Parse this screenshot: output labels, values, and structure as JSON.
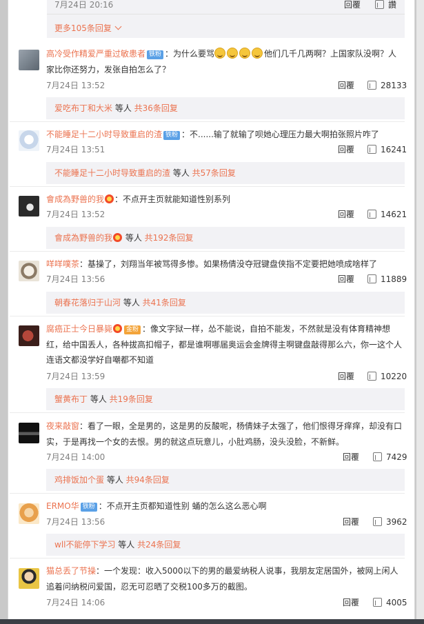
{
  "top": {
    "date": "7月24日 20:16",
    "reply": "回覆",
    "like": "讚",
    "more": "更多105条回复"
  },
  "reply_label": "回覆",
  "comments": [
    {
      "user": "高冷受作精爱严重过敏患者",
      "badge": "铁粉",
      "text_a": "：为什么要骂",
      "text_b": "他们几千几两啊？上国家队没啊？人家比你还努力，发张自拍怎么了？",
      "time": "7月24日 13:52",
      "likes": "28133",
      "r_user": "爱吃布丁和大米",
      "r_mid": " 等人 ",
      "r_count": "共36条回复"
    },
    {
      "user": "不能睡足十二小时导致重启的渣",
      "badge": "铁粉",
      "text": "：不......输了就输了呗她心理压力最大啊拍张照片咋了",
      "time": "7月24日 13:51",
      "likes": "16241",
      "r_user": "不能睡足十二小时导致重启的渣",
      "r_mid": " 等人 ",
      "r_count": "共57条回复"
    },
    {
      "user": "會成為野兽的我",
      "text": "：不点开主页就能知道性别系列",
      "time": "7月24日 13:52",
      "likes": "14621",
      "r_user": "會成為野兽的我",
      "r_mid": " 等人 ",
      "r_count": "共192条回复"
    },
    {
      "user": "咩咩噗茶",
      "text": "：基操了，刘翔当年被骂得多惨。如果杨倩没夺冠键盘侠指不定要把她喷成啥样了",
      "time": "7月24日 13:56",
      "likes": "11889",
      "r_user": "朝春花落归于山河",
      "r_mid": " 等人 ",
      "r_count": "共41条回复"
    },
    {
      "user": "腐癌正士今日暴毙",
      "badge": "金粉",
      "text": "：像文字狱一样，怂不能说，自拍不能发，不然就是没有体育精神想红，给中国丢人，各种拔高扣帽子，都是谁啊哪届奥运会金牌得主啊键盘敲得那么六，你一这个人连语文都没学好自嘲都不知道",
      "time": "7月24日 13:59",
      "likes": "10220",
      "r_user": "蟹黄布丁",
      "r_mid": " 等人 ",
      "r_count": "共19条回复"
    },
    {
      "user": "夜来敲窗",
      "text": "：看了一眼，全是男的，这是男的反酸呢，杨倩妹子太强了，他们恨得牙痒痒，却没有口实，于是再找一个女的去恨。男的就这点玩意儿，小肚鸡肠，没头没脸，不新鲜。",
      "time": "7月24日 14:00",
      "likes": "7429",
      "r_user": "鸡排饭加个蛋",
      "r_mid": " 等人 ",
      "r_count": "共94条回复"
    },
    {
      "user": "ERMO华",
      "badge": "铁粉",
      "text": "：不点开主页都知道性别 蛹的怎么这么恶心啊",
      "time": "7月24日 13:56",
      "likes": "3962",
      "r_user": "wll不能停下学习",
      "r_mid": " 等人 ",
      "r_count": "共24条回复"
    },
    {
      "user": "猫总丢了节操",
      "text": "：一个发现：收入5000以下的男的最爱纳税人说事，我朋友定居国外，被网上闲人追着问纳税问爱国，忍无可忍晒了交税100多万的截图。",
      "time": "7月24日 14:06",
      "likes": "4005"
    }
  ],
  "colors": {
    "name": "#eb7350",
    "reply_bg": "#f2f2f5",
    "badge": "#5aa0e6"
  },
  "icons": {
    "like": "thumb-up-icon",
    "more": "chevron-down-icon"
  }
}
